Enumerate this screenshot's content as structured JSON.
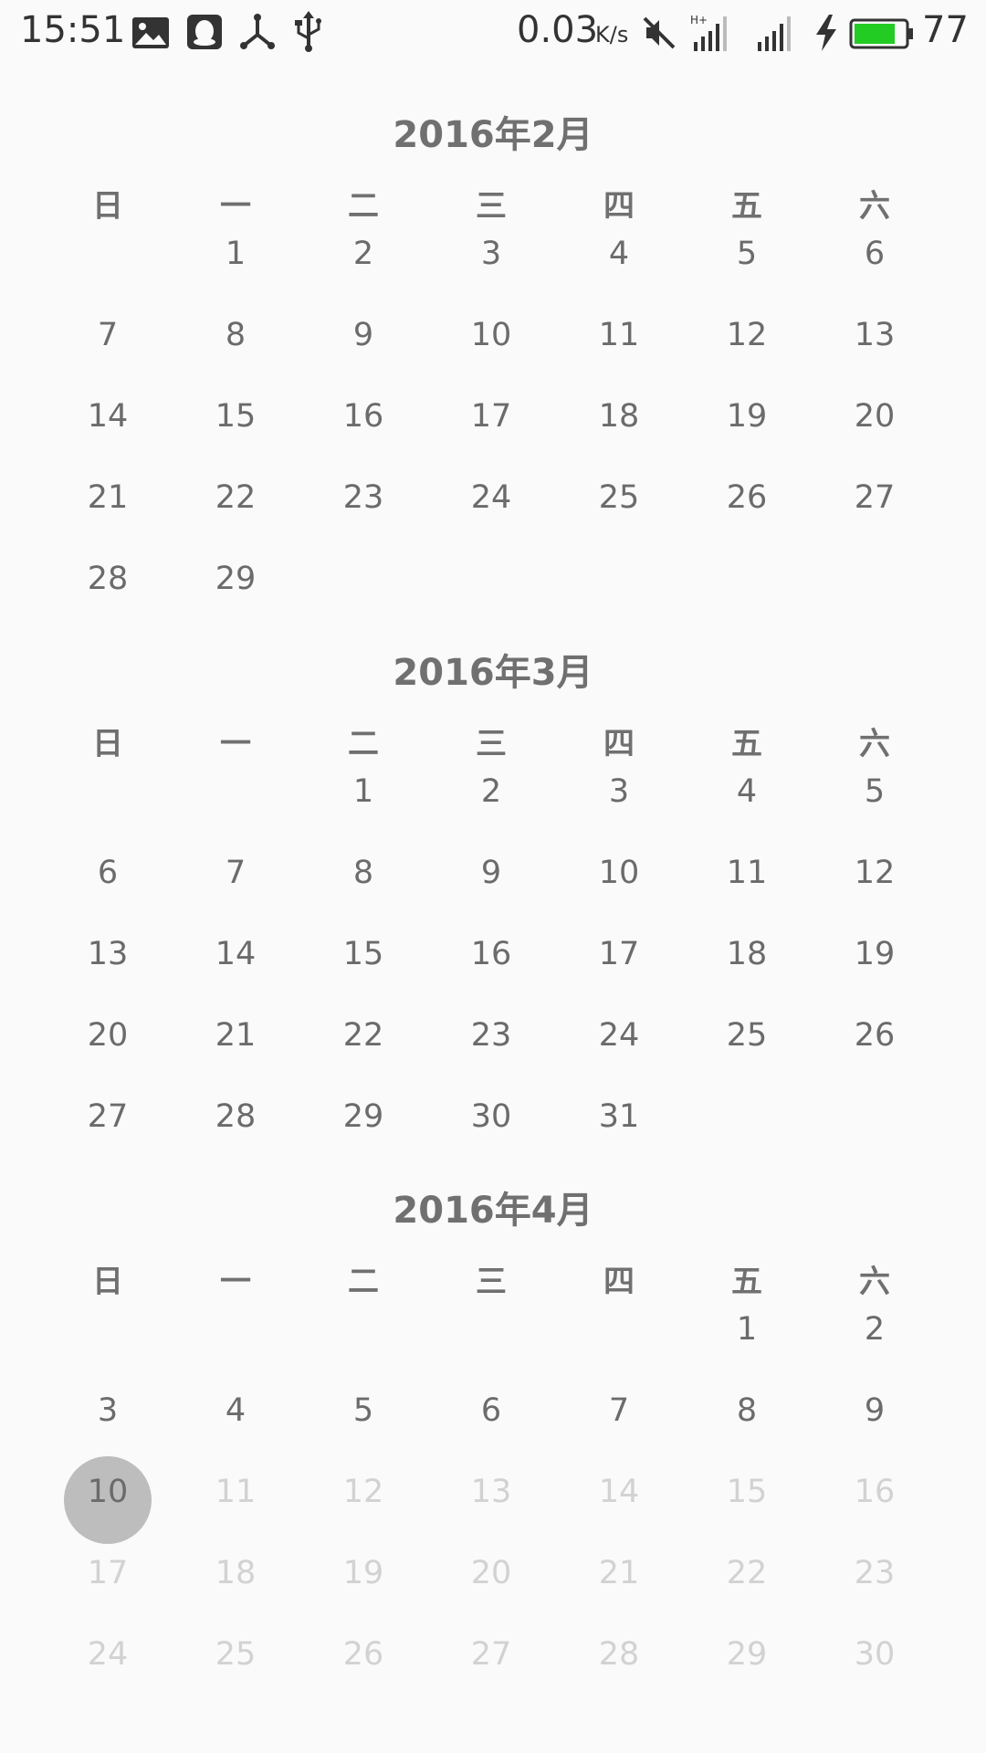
{
  "status_bar": {
    "time": "15:51",
    "net_speed": "0.03",
    "net_speed_unit": "K/s",
    "battery_level": "77",
    "battery_color": "#22cc22",
    "icons": [
      "image-icon",
      "qq-icon",
      "share-icon",
      "usb-icon",
      "mute-icon",
      "hplus-signal-icon",
      "signal-icon",
      "charging-icon",
      "battery-icon"
    ]
  },
  "calendar": {
    "weekdays": [
      "日",
      "一",
      "二",
      "三",
      "四",
      "五",
      "六"
    ],
    "selected_color": "#bdbdbd",
    "months": [
      {
        "title": "2016年2月",
        "first_weekday": 1,
        "days": 29
      },
      {
        "title": "2016年3月",
        "first_weekday": 2,
        "days": 31
      },
      {
        "title": "2016年4月",
        "first_weekday": 5,
        "days": 30,
        "selected_day": 10
      }
    ]
  }
}
